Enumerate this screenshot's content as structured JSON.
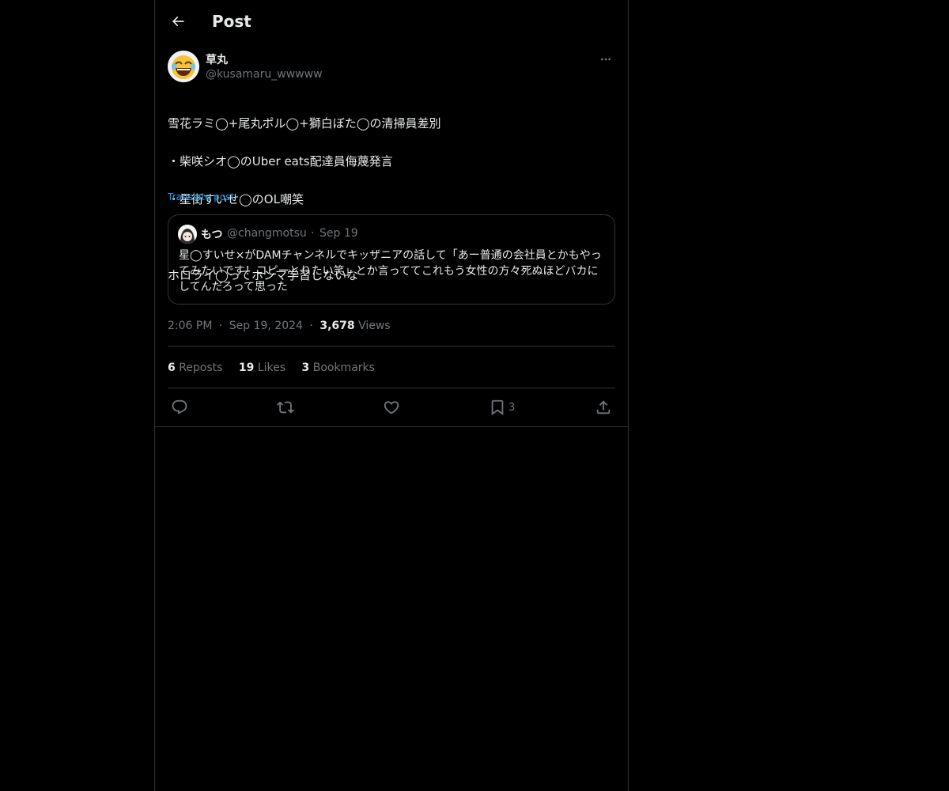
{
  "header": {
    "title": "Post"
  },
  "post": {
    "author": {
      "name": "草丸",
      "handle": "@kusamaru_wwwww",
      "avatar_icon": "laughing-emoji-icon"
    },
    "text_lines": [
      "雪花ラミ◯+尾丸ポル◯+獅白ぼた◯の清掃員差別",
      "・柴咲シオ◯のUber eats配達員侮蔑発言",
      "・星街すいせ◯のOL嘲笑",
      "",
      "ホロライ◯ってホンマ学習しないな"
    ],
    "translate_label": "Translate post",
    "quote": {
      "name": "もつ",
      "handle": "@changmotsu",
      "separator": "·",
      "date": "Sep 19",
      "text": "星◯すいせ×がDAMチャンネルでキッザニアの話して「あー普通の会社員とかもやってみたいです！コピーとりたい笑」とか言っててこれもう女性の方々死ぬほどバカにしてんだろって思った"
    },
    "meta": {
      "time": "2:06 PM",
      "separator": "·",
      "date": "Sep 19, 2024",
      "views_count": "3,678",
      "views_label": "Views"
    },
    "stats": {
      "reposts_count": "6",
      "reposts_label": "Reposts",
      "likes_count": "19",
      "likes_label": "Likes",
      "bookmarks_count": "3",
      "bookmarks_label": "Bookmarks"
    },
    "actions": {
      "reply_icon": "reply-icon",
      "repost_icon": "repost-icon",
      "like_icon": "heart-icon",
      "bookmark_icon": "bookmark-icon",
      "bookmark_count": "3",
      "share_icon": "share-icon"
    }
  },
  "colors": {
    "background": "#000000",
    "text": "#e7e9ea",
    "muted": "#71767b",
    "link": "#1d9bf0",
    "border": "#2f3336"
  }
}
